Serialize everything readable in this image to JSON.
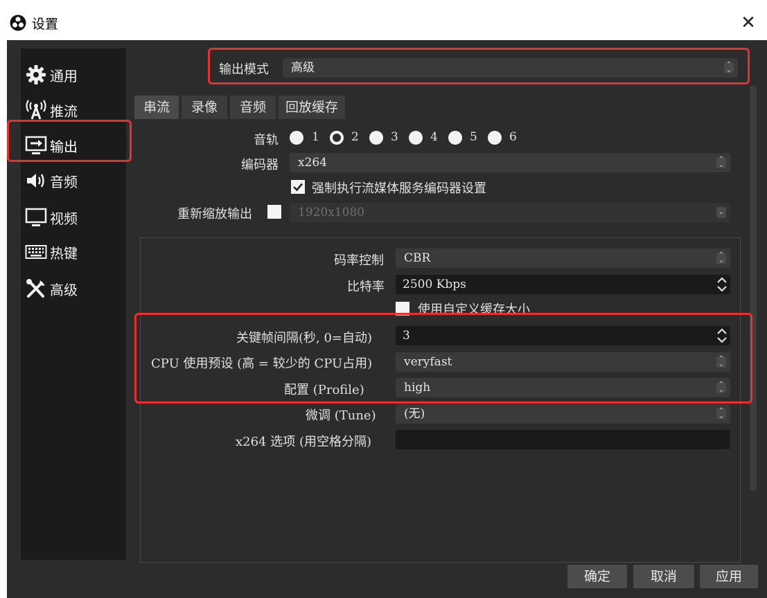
{
  "window": {
    "title": "设置",
    "close_glyph": "✕"
  },
  "sidebar": {
    "items": [
      {
        "label": "通用",
        "icon": "gear-icon"
      },
      {
        "label": "推流",
        "icon": "antenna-icon"
      },
      {
        "label": "输出",
        "icon": "monitor-arrow-icon",
        "active": true
      },
      {
        "label": "音频",
        "icon": "speaker-icon"
      },
      {
        "label": "视频",
        "icon": "monitor-icon"
      },
      {
        "label": "热键",
        "icon": "keyboard-icon"
      },
      {
        "label": "高级",
        "icon": "tools-icon"
      }
    ]
  },
  "output_mode": {
    "label": "输出模式",
    "value": "高级"
  },
  "tabs": [
    {
      "label": "串流",
      "active": true
    },
    {
      "label": "录像"
    },
    {
      "label": "音频"
    },
    {
      "label": "回放缓存"
    }
  ],
  "stream": {
    "audio_track_label": "音轨",
    "tracks": [
      "1",
      "2",
      "3",
      "4",
      "5",
      "6"
    ],
    "selected_track": "2",
    "encoder_label": "编码器",
    "encoder_value": "x264",
    "enforce_label": "强制执行流媒体服务编码器设置",
    "enforce_checked": true,
    "rescale_label": "重新缩放输出",
    "rescale_checked": false,
    "rescale_value": "1920x1080"
  },
  "encoder_settings": {
    "rate_control_label": "码率控制",
    "rate_control_value": "CBR",
    "bitrate_label": "比特率",
    "bitrate_value": "2500 Kbps",
    "custom_buffer_label": "使用自定义缓存大小",
    "keyframe_label": "关键帧间隔(秒, 0=自动)",
    "keyframe_value": "3",
    "cpu_preset_label": "CPU 使用预设 (高 = 较少的 CPU占用)",
    "cpu_preset_value": "veryfast",
    "profile_label": "配置 (Profile)",
    "profile_value": "high",
    "tune_label": "微调 (Tune)",
    "tune_value": "(无)",
    "x264_opts_label": "x264 选项 (用空格分隔)",
    "x264_opts_value": ""
  },
  "buttons": {
    "ok": "确定",
    "cancel": "取消",
    "apply": "应用"
  },
  "colors": {
    "highlight": "#e8302e",
    "background": "#2c2c2c",
    "sidebar": "#1b1b1b"
  }
}
